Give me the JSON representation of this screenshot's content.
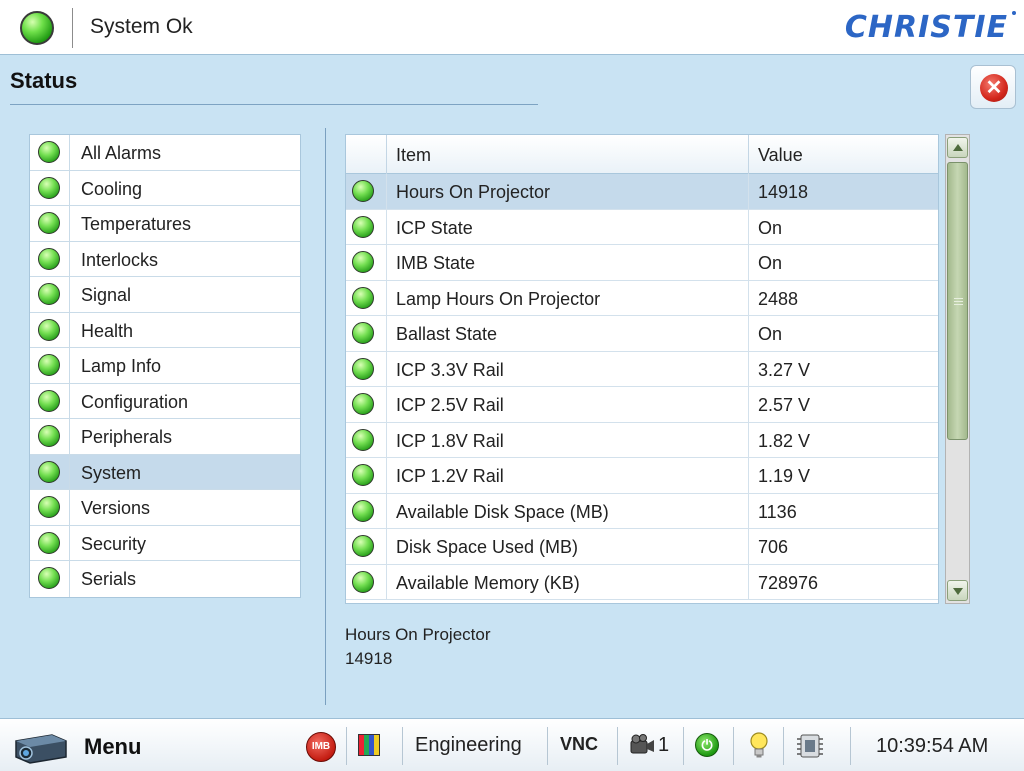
{
  "header": {
    "status_text": "System Ok",
    "brand": "CHRISTIE",
    "brand_color": "#2c66c5",
    "status_led": "green-led-icon"
  },
  "page": {
    "title": "Status",
    "close_icon": "close-icon"
  },
  "categories": [
    {
      "label": "All Alarms"
    },
    {
      "label": "Cooling"
    },
    {
      "label": "Temperatures"
    },
    {
      "label": "Interlocks"
    },
    {
      "label": "Signal"
    },
    {
      "label": "Health"
    },
    {
      "label": "Lamp Info"
    },
    {
      "label": "Configuration"
    },
    {
      "label": "Peripherals"
    },
    {
      "label": "System",
      "selected": true
    },
    {
      "label": "Versions"
    },
    {
      "label": "Security"
    },
    {
      "label": "Serials"
    }
  ],
  "table": {
    "columns": {
      "item": "Item",
      "value": "Value"
    },
    "rows": [
      {
        "item": "Hours On Projector",
        "value": "14918"
      },
      {
        "item": "ICP State",
        "value": "On"
      },
      {
        "item": "IMB State",
        "value": "On"
      },
      {
        "item": "Lamp Hours On Projector",
        "value": "2488"
      },
      {
        "item": "Ballast State",
        "value": "On"
      },
      {
        "item": "ICP 3.3V Rail",
        "value": "3.27 V"
      },
      {
        "item": "ICP 2.5V Rail",
        "value": "2.57 V"
      },
      {
        "item": "ICP 1.8V Rail",
        "value": "1.82 V"
      },
      {
        "item": "ICP 1.2V Rail",
        "value": "1.19 V"
      },
      {
        "item": "Available Disk Space (MB)",
        "value": "1136"
      },
      {
        "item": "Disk Space Used (MB)",
        "value": "706"
      },
      {
        "item": "Available Memory (KB)",
        "value": "728976"
      }
    ]
  },
  "detail": {
    "name": "Hours On Projector",
    "value": "14918"
  },
  "footer": {
    "menu_label": "Menu",
    "imb_badge": "IMB",
    "engineering_label": "Engineering",
    "vnc_label": "VNC",
    "camera_count": "1",
    "clock": "10:39:54 AM",
    "icons": [
      "projector-icon",
      "imb-icon",
      "test-pattern-icon",
      "camera-icon",
      "power-icon",
      "lamp-bulb-icon",
      "dmd-icon"
    ]
  },
  "colors": {
    "background": "#c9e3f3",
    "selected_row": "#c5daeb",
    "status_ok": "#2fa31f"
  }
}
